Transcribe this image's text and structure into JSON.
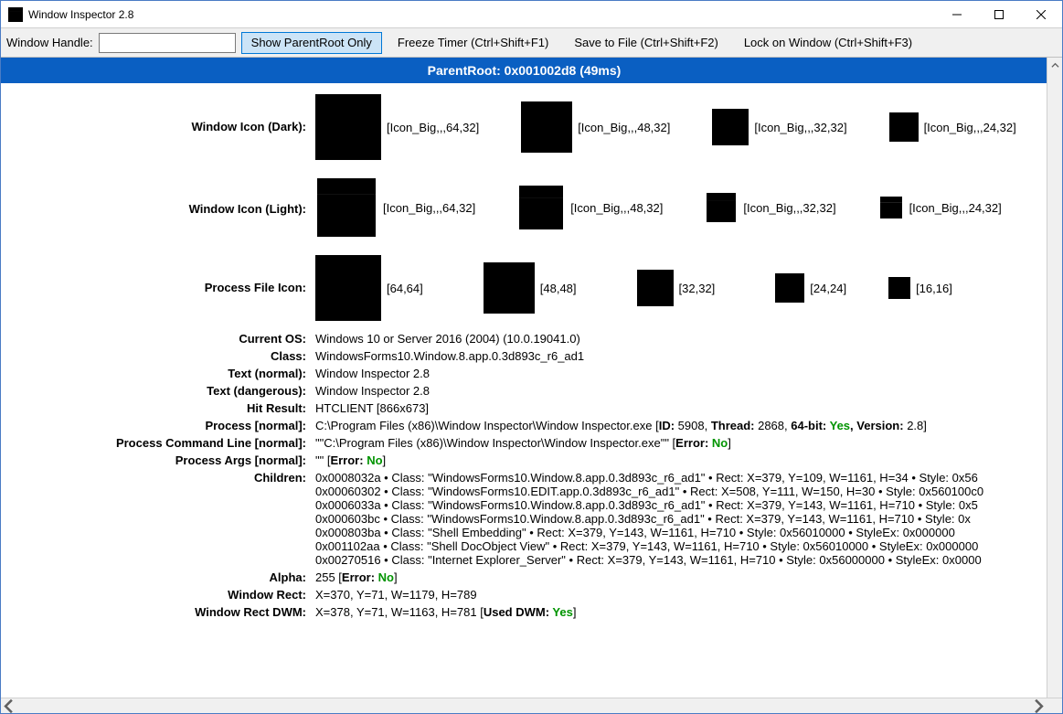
{
  "window": {
    "title": "Window Inspector 2.8"
  },
  "toolbar": {
    "handle_label": "Window Handle:",
    "handle_value": "",
    "show_parent_root": "Show ParentRoot Only",
    "freeze_timer": "Freeze Timer (Ctrl+Shift+F1)",
    "save_to_file": "Save to File (Ctrl+Shift+F2)",
    "lock_on_window": "Lock on Window (Ctrl+Shift+F3)"
  },
  "banner": "ParentRoot: 0x001002d8 (49ms)",
  "rows": {
    "window_icon_dark": {
      "label": "Window Icon (Dark):",
      "items": [
        "[Icon_Big,,,64,32]",
        "[Icon_Big,,,48,32]",
        "[Icon_Big,,,32,32]",
        "[Icon_Big,,,24,32]"
      ]
    },
    "window_icon_light": {
      "label": "Window Icon (Light):",
      "items": [
        "[Icon_Big,,,64,32]",
        "[Icon_Big,,,48,32]",
        "[Icon_Big,,,32,32]",
        "[Icon_Big,,,24,32]"
      ]
    },
    "process_file_icon": {
      "label": "Process File Icon:",
      "items": [
        "[64,64]",
        "[48,48]",
        "[32,32]",
        "[24,24]",
        "[16,16]"
      ]
    },
    "current_os": {
      "label": "Current OS:",
      "value": "Windows 10 or Server 2016 (2004) (10.0.19041.0)"
    },
    "class": {
      "label": "Class:",
      "value": "WindowsForms10.Window.8.app.0.3d893c_r6_ad1"
    },
    "text_normal": {
      "label": "Text (normal):",
      "value": "Window Inspector 2.8"
    },
    "text_dangerous": {
      "label": "Text (dangerous):",
      "value": "Window Inspector 2.8"
    },
    "hit_result": {
      "label": "Hit Result:",
      "value": "HTCLIENT [866x673]"
    },
    "process_normal": {
      "label": "Process [normal]:",
      "path": "C:\\Program Files (x86)\\Window Inspector\\Window Inspector.exe [",
      "id_lbl": "ID:",
      "id_val": " 5908, ",
      "thread_lbl": "Thread:",
      "thread_val": " 2868, ",
      "bit_lbl": "64-bit:",
      "bit_val": " Yes",
      "ver_lbl": ", Version:",
      "ver_val": " 2.8]"
    },
    "process_cmd": {
      "label": "Process Command Line [normal]:",
      "value_pre": "\"\"C:\\Program Files (x86)\\Window Inspector\\Window Inspector.exe\"\" [",
      "err_lbl": "Error:",
      "err_val": " No",
      "post": "]"
    },
    "process_args": {
      "label": "Process Args [normal]:",
      "value_pre": "\"\" [",
      "err_lbl": "Error:",
      "err_val": " No",
      "post": "]"
    },
    "children": {
      "label": "Children:",
      "lines": [
        "0x0008032a • Class: \"WindowsForms10.Window.8.app.0.3d893c_r6_ad1\" • Rect: X=379, Y=109, W=1161, H=34 • Style: 0x56",
        "0x00060302 • Class: \"WindowsForms10.EDIT.app.0.3d893c_r6_ad1\" • Rect: X=508, Y=111, W=150, H=30 • Style: 0x560100c0",
        "0x0006033a • Class: \"WindowsForms10.Window.8.app.0.3d893c_r6_ad1\" • Rect: X=379, Y=143, W=1161, H=710 • Style: 0x5",
        "0x000603bc • Class: \"WindowsForms10.Window.8.app.0.3d893c_r6_ad1\" • Rect: X=379, Y=143, W=1161, H=710 • Style: 0x",
        "0x000803ba • Class: \"Shell Embedding\" • Rect: X=379, Y=143, W=1161, H=710 • Style: 0x56010000 • StyleEx: 0x000000",
        "0x001102aa • Class: \"Shell DocObject View\" • Rect: X=379, Y=143, W=1161, H=710 • Style: 0x56010000 • StyleEx: 0x000000",
        "0x00270516 • Class: \"Internet Explorer_Server\" • Rect: X=379, Y=143, W=1161, H=710 • Style: 0x56000000 • StyleEx: 0x0000"
      ]
    },
    "alpha": {
      "label": "Alpha:",
      "value_pre": "255 [",
      "err_lbl": "Error:",
      "err_val": " No",
      "post": "]"
    },
    "window_rect": {
      "label": "Window Rect:",
      "value": "X=370, Y=71, W=1179, H=789"
    },
    "window_rect_dwm": {
      "label": "Window Rect DWM:",
      "value_pre": "X=378, Y=71, W=1163, H=781 [",
      "dwm_lbl": "Used DWM:",
      "dwm_val": " Yes",
      "post": "]"
    }
  }
}
